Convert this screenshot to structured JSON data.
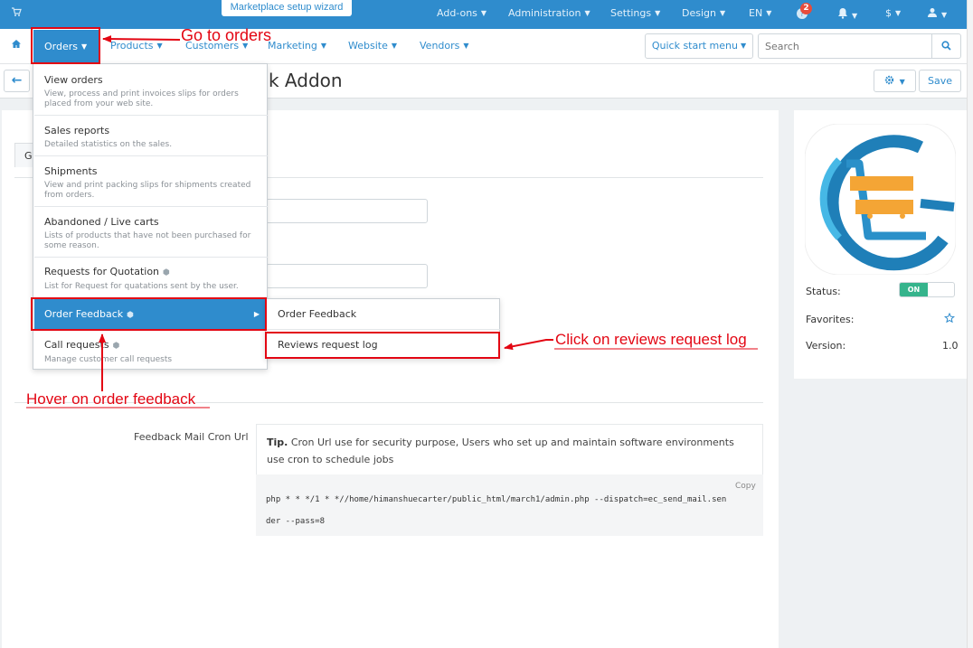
{
  "topbar": {
    "wizard_label": "Marketplace setup wizard",
    "menus": [
      "Add-ons",
      "Administration",
      "Settings",
      "Design",
      "EN"
    ],
    "notification_count": "2",
    "currency": "$",
    "cart_icon": "cart-icon",
    "bell_icon": "bell-icon",
    "user_icon": "user-icon"
  },
  "nav": {
    "home_icon": "home-icon",
    "items": [
      "Orders",
      "Products",
      "Customers",
      "Marketing",
      "Website",
      "Vendors"
    ],
    "quick_start": "Quick start menu",
    "search_placeholder": "Search"
  },
  "page": {
    "title": "ck Addon",
    "save_label": "Save",
    "tab_partial": "Ge"
  },
  "orders_menu": [
    {
      "title": "View orders",
      "desc": "View, process and print invoices slips for orders placed from your web site."
    },
    {
      "title": "Sales reports",
      "desc": "Detailed statistics on the sales."
    },
    {
      "title": "Shipments",
      "desc": "View and print packing slips for shipments created from orders."
    },
    {
      "title": "Abandoned / Live carts",
      "desc": "Lists of products that have not been purchased for some reason."
    },
    {
      "title": "Requests for Quotation",
      "desc": "List for Request for quatations sent by the user."
    },
    {
      "title": "Order Feedback",
      "desc": ""
    },
    {
      "title": "Call requests",
      "desc": "Manage customer call requests"
    }
  ],
  "submenu": [
    "Order Feedback",
    "Reviews request log"
  ],
  "cron": {
    "label": "Feedback Mail Cron Url",
    "tip_bold": "Tip.",
    "tip_text": "Cron Url use for security purpose, Users who set up and maintain software environments use cron to schedule jobs",
    "copy_label": "Copy",
    "command": "php * * */1 * *//home/himanshuecarter/public_html/march1/admin.php --dispatch=ec_send_mail.sender --pass=8"
  },
  "sidebar": {
    "status_label": "Status:",
    "status_value": "ON",
    "favorites_label": "Favorites:",
    "version_label": "Version:",
    "version_value": "1.0"
  },
  "annotations": {
    "go_to_orders": "Go to orders",
    "hover_feedback": "Hover on order feedback",
    "click_reviews": "Click on reviews request log"
  },
  "colors": {
    "primary": "#2f8ccd",
    "annotation": "#e30613",
    "on_toggle": "#35b48c"
  }
}
